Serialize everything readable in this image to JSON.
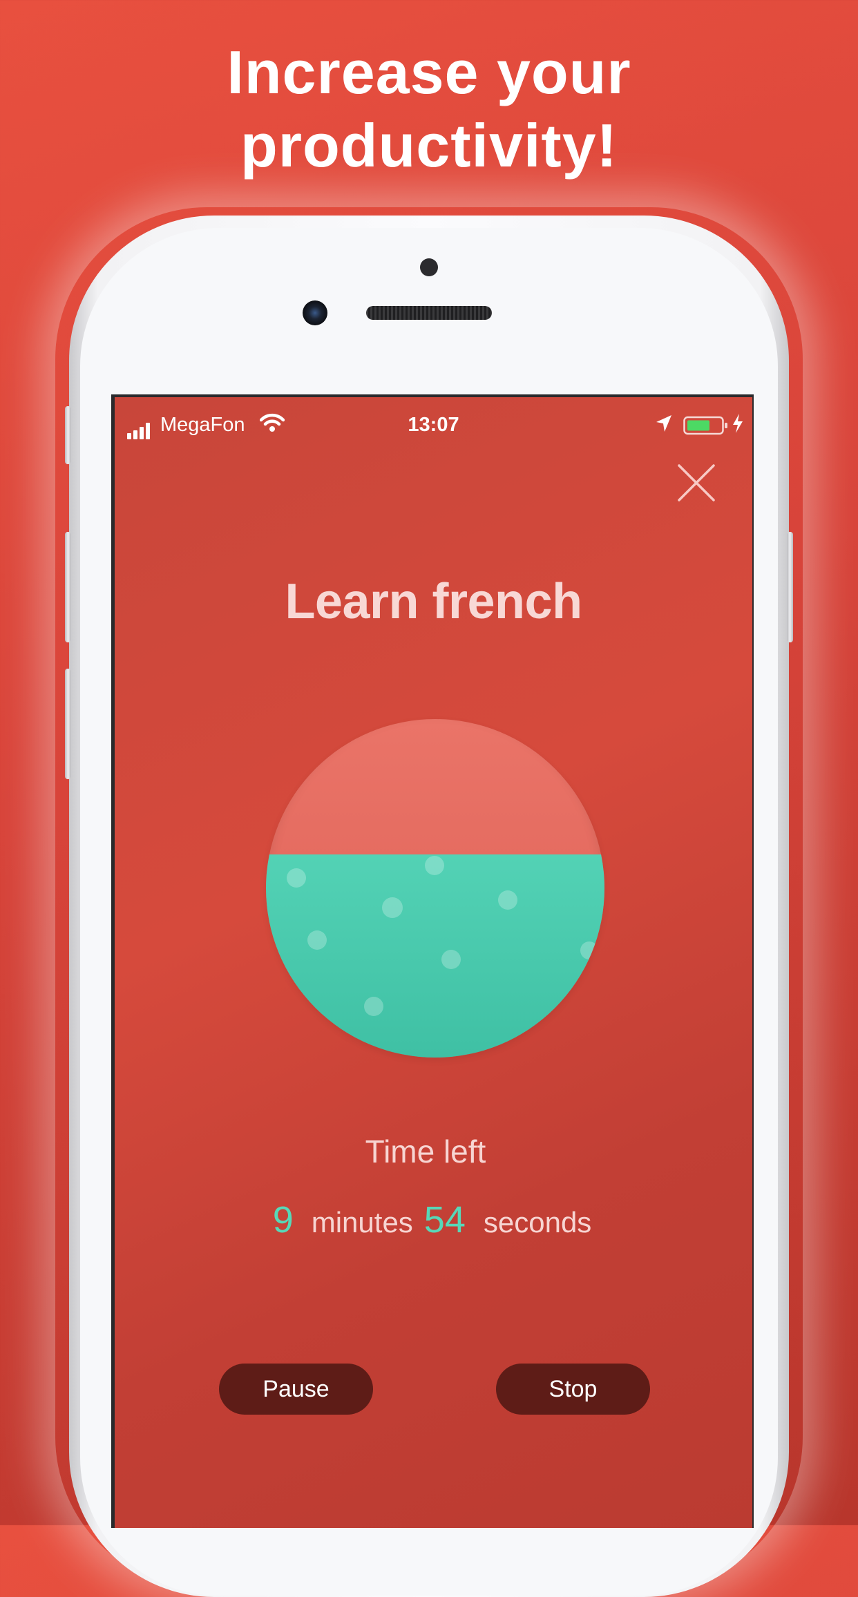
{
  "headline": {
    "line1": "Increase your",
    "line2": "productivity!"
  },
  "status_bar": {
    "carrier": "MegaFon",
    "time": "13:07",
    "battery_color": "#4cd964"
  },
  "timer_screen": {
    "close_icon": "close-icon",
    "task_title": "Learn french",
    "progress_fill": 0.6,
    "time_left_label": "Time left",
    "minutes_value": "9",
    "minutes_label": "minutes",
    "seconds_value": "54",
    "seconds_label": "seconds",
    "pause_label": "Pause",
    "stop_label": "Stop"
  },
  "colors": {
    "background": "#e24b3d",
    "water": "#4cccb0",
    "accent_number": "#57d8b8",
    "button": "#5e1c17"
  }
}
